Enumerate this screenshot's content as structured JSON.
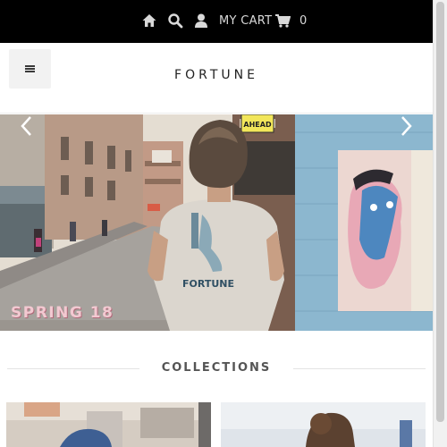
{
  "topbar": {
    "icons": [
      "home-icon",
      "search-icon",
      "user-icon",
      "cart-icon"
    ],
    "cart_label": "MY CART",
    "cart_count": "0"
  },
  "header": {
    "brand": "FORTUNE",
    "menu_icon": "menu-icon"
  },
  "hero": {
    "caption": "SPRING 18",
    "shirt_print": "FORTUNE",
    "street_sign": "AHEAD",
    "prev_icon": "chevron-left-icon",
    "next_icon": "chevron-right-icon"
  },
  "collections": {
    "title": "COLLECTIONS"
  },
  "colors": {
    "topbar_bg": "#000000",
    "accent_caption": "#f2c9d1"
  }
}
